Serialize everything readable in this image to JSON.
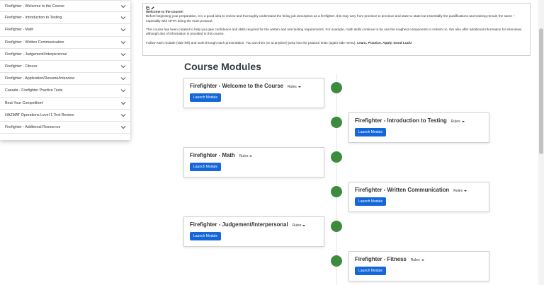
{
  "sidebar": {
    "items": [
      {
        "label": "Firefighter - Welcome to the Course"
      },
      {
        "label": "Firefighter - Introduction to Testing"
      },
      {
        "label": "Firefighter - Math"
      },
      {
        "label": "Firefighter - Written Communication"
      },
      {
        "label": "Firefighter - Judgement/Interpersonal"
      },
      {
        "label": "Firefighter - Fitness"
      },
      {
        "label": "Firefighter - Application/Resume/Interview"
      },
      {
        "label": "Canada - Firefighter Practice Tests"
      },
      {
        "label": "Beat Your Competition!"
      },
      {
        "label": "HAZMAT Operations Level 1 Text Review"
      },
      {
        "label": "Firefighter - Additional Resources"
      }
    ]
  },
  "intro": {
    "heading": "Welcome to the course!",
    "para1": "Before beginning your preparation, it is a good idea to review and thoroughly understand the hiring job description as a firefighter, this may vary from province to province and state to state but essentially the qualifications and training remain the same – especially with NFPA being the main protocol.",
    "para2": "This course has been created to help you gain confidence and skills required for the written and oral testing requirements. For example, math skills continue to be one the toughest components to refresh on. We also offer additional information for interviews although alot of information is provided in this course.",
    "para3": "Follow each module (side left) and work through each presentation. You can then (or at anytime) jump into the practice tests (again side menu).",
    "para3_bold": "Learn. Practice. Apply.  Good Luck!"
  },
  "main": {
    "title": "Course Modules",
    "rules_label": "Rules",
    "launch_label": "Launch Module",
    "modules": [
      {
        "title": "Firefighter - Welcome to the Course"
      },
      {
        "title": "Firefighter - Introduction to Testing"
      },
      {
        "title": "Firefighter - Math"
      },
      {
        "title": "Firefighter - Written Communication"
      },
      {
        "title": "Firefighter - Judgement/Interpersonal"
      },
      {
        "title": "Firefighter - Fitness"
      }
    ]
  },
  "colors": {
    "accent": "#1467d8",
    "timeline_dot": "#3d8b3d"
  }
}
